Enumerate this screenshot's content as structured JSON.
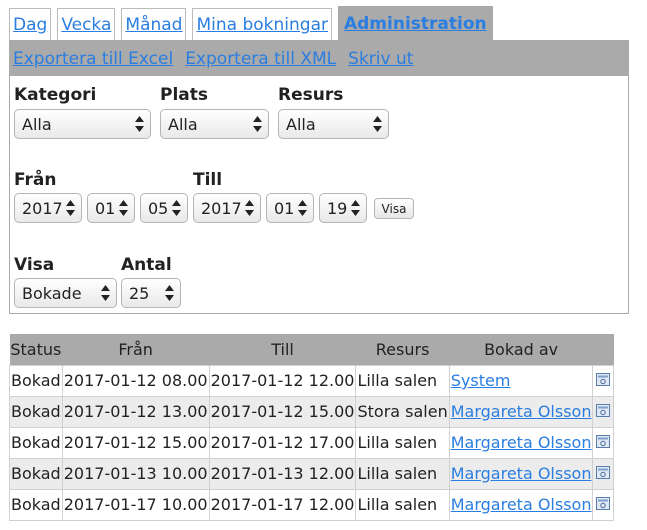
{
  "tabs": [
    {
      "label": "Dag",
      "active": false
    },
    {
      "label": "Vecka",
      "active": false
    },
    {
      "label": "Månad",
      "active": false
    },
    {
      "label": "Mina bokningar",
      "active": false
    },
    {
      "label": "Administration",
      "active": true
    }
  ],
  "links": {
    "excel": "Exportera till Excel",
    "xml": "Exportera till XML",
    "print": "Skriv ut"
  },
  "filters": {
    "kategori_label": "Kategori",
    "kategori_value": "Alla",
    "plats_label": "Plats",
    "plats_value": "Alla",
    "resurs_label": "Resurs",
    "resurs_value": "Alla",
    "fran_label": "Från",
    "fran_year": "2017",
    "fran_month": "01",
    "fran_day": "05",
    "till_label": "Till",
    "till_year": "2017",
    "till_month": "01",
    "till_day": "19",
    "visa_button": "Visa",
    "visa_label": "Visa",
    "visa_value": "Bokade",
    "antal_label": "Antal",
    "antal_value": "25"
  },
  "table": {
    "headers": [
      "Status",
      "Från",
      "Till",
      "Resurs",
      "Bokad av"
    ],
    "rows": [
      {
        "status": "Bokad",
        "from": "2017-01-12 08.00",
        "to": "2017-01-12 12.00",
        "resource": "Lilla salen",
        "user": "System"
      },
      {
        "status": "Bokad",
        "from": "2017-01-12 13.00",
        "to": "2017-01-12 15.00",
        "resource": "Stora salen",
        "user": "Margareta Olsson"
      },
      {
        "status": "Bokad",
        "from": "2017-01-12 15.00",
        "to": "2017-01-12 17.00",
        "resource": "Lilla salen",
        "user": "Margareta Olsson"
      },
      {
        "status": "Bokad",
        "from": "2017-01-13 10.00",
        "to": "2017-01-13 12.00",
        "resource": "Lilla salen",
        "user": "Margareta Olsson"
      },
      {
        "status": "Bokad",
        "from": "2017-01-17 10.00",
        "to": "2017-01-17 12.00",
        "resource": "Lilla salen",
        "user": "Margareta Olsson"
      }
    ],
    "row_icon": "details-icon"
  },
  "colors": {
    "link": "#2a7de1",
    "bar": "#aaaaaa"
  }
}
